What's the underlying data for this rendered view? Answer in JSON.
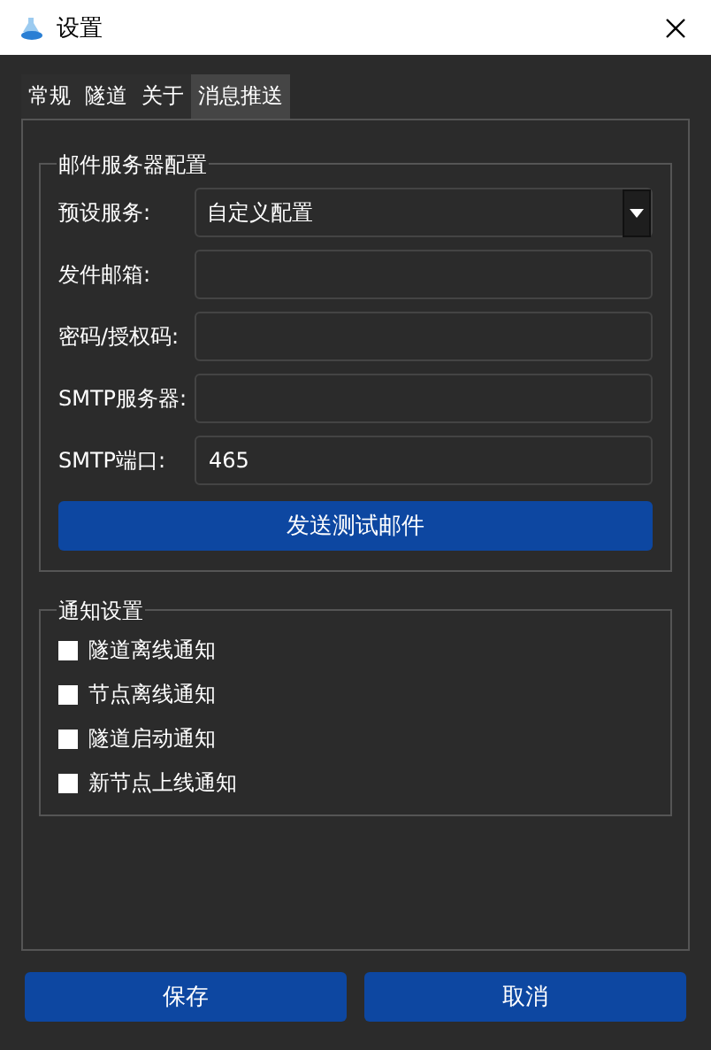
{
  "window": {
    "title": "设置"
  },
  "tabs": [
    {
      "label": "常规",
      "selected": false
    },
    {
      "label": "隧道",
      "selected": false
    },
    {
      "label": "关于",
      "selected": false
    },
    {
      "label": "消息推送",
      "selected": true
    }
  ],
  "mail_server": {
    "title": "邮件服务器配置",
    "fields": [
      {
        "kind": "dropdown",
        "label": "预设服务:",
        "value": "自定义配置"
      },
      {
        "kind": "input",
        "label": "发件邮箱:"
      },
      {
        "kind": "input",
        "label": "密码/授权码:"
      },
      {
        "kind": "input",
        "label": "SMTP服务器:"
      },
      {
        "kind": "input",
        "label": "SMTP端口:",
        "value": "465"
      }
    ],
    "test_button": "发送测试邮件"
  },
  "notifications": {
    "title": "通知设置",
    "options": [
      {
        "label": "隧道离线通知",
        "checked": false
      },
      {
        "label": "节点离线通知",
        "checked": false
      },
      {
        "label": "隧道启动通知",
        "checked": false
      },
      {
        "label": "新节点上线通知",
        "checked": false
      }
    ]
  },
  "buttons": [
    "保存",
    "取消"
  ]
}
